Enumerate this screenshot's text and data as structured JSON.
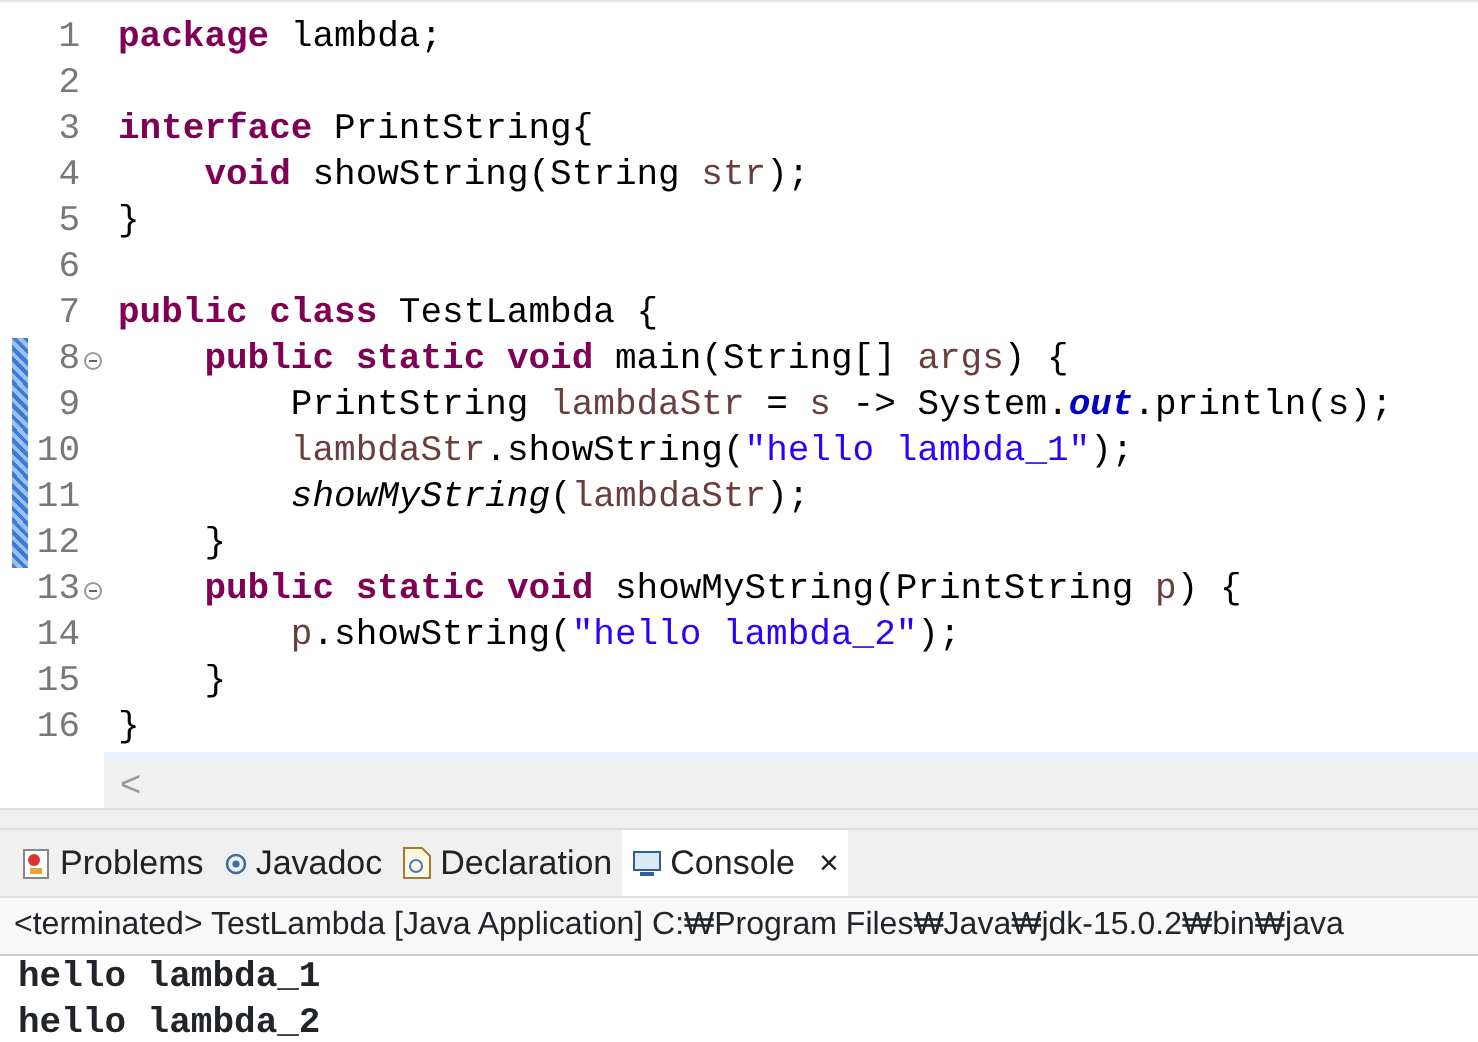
{
  "editor": {
    "lines": [
      {
        "number": "1",
        "changed": false,
        "foldable": false,
        "tokens": [
          {
            "kind": "kw",
            "text": "package"
          },
          {
            "kind": "plain",
            "text": " lambda;"
          }
        ]
      },
      {
        "number": "2",
        "changed": false,
        "foldable": false
      },
      {
        "number": "3",
        "changed": false,
        "foldable": false,
        "tokens": [
          {
            "kind": "kw",
            "text": "interface"
          },
          {
            "kind": "plain",
            "text": " PrintString{"
          }
        ]
      },
      {
        "number": "4",
        "changed": false,
        "foldable": false,
        "tokens": [
          {
            "kind": "kw",
            "text": "    void"
          },
          {
            "kind": "plain",
            "text": " showString(String "
          },
          {
            "kind": "var",
            "text": "str"
          },
          {
            "kind": "plain",
            "text": ");"
          }
        ]
      },
      {
        "number": "5",
        "changed": false,
        "foldable": false,
        "tokens": [
          {
            "kind": "plain",
            "text": "}"
          }
        ]
      },
      {
        "number": "6",
        "changed": false,
        "foldable": false
      },
      {
        "number": "7",
        "changed": false,
        "foldable": false,
        "tokens": [
          {
            "kind": "kw",
            "text": "public"
          },
          {
            "kind": "kw",
            "text": " class"
          },
          {
            "kind": "plain",
            "text": " TestLambda {"
          }
        ]
      },
      {
        "number": "8",
        "changed": true,
        "foldable": true,
        "tokens": [
          {
            "kind": "kw",
            "text": "    public"
          },
          {
            "kind": "kw",
            "text": " static"
          },
          {
            "kind": "kw",
            "text": " void"
          },
          {
            "kind": "plain",
            "text": " main(String[] "
          },
          {
            "kind": "var",
            "text": "args"
          },
          {
            "kind": "plain",
            "text": ") {"
          }
        ]
      },
      {
        "number": "9",
        "changed": true,
        "foldable": false,
        "tokens": [
          {
            "kind": "plain",
            "text": "        PrintString "
          },
          {
            "kind": "var",
            "text": "lambdaStr"
          },
          {
            "kind": "plain",
            "text": " = "
          },
          {
            "kind": "var",
            "text": "s"
          },
          {
            "kind": "plain",
            "text": " -> System."
          },
          {
            "kind": "field",
            "text": "out"
          },
          {
            "kind": "plain",
            "text": ".println(s);"
          }
        ]
      },
      {
        "number": "10",
        "changed": true,
        "foldable": false,
        "tokens": [
          {
            "kind": "var",
            "text": "        lambdaStr"
          },
          {
            "kind": "plain",
            "text": ".showString("
          },
          {
            "kind": "str",
            "text": "\"hello lambda_1\""
          },
          {
            "kind": "plain",
            "text": ");"
          }
        ]
      },
      {
        "number": "11",
        "changed": true,
        "foldable": false,
        "tokens": [
          {
            "kind": "static",
            "text": "        showMyString"
          },
          {
            "kind": "plain",
            "text": "("
          },
          {
            "kind": "var",
            "text": "lambdaStr"
          },
          {
            "kind": "plain",
            "text": ");"
          }
        ]
      },
      {
        "number": "12",
        "changed": true,
        "foldable": false,
        "tokens": [
          {
            "kind": "plain",
            "text": "    }"
          }
        ]
      },
      {
        "number": "13",
        "changed": false,
        "foldable": true,
        "tokens": [
          {
            "kind": "kw",
            "text": "    public"
          },
          {
            "kind": "kw",
            "text": " static"
          },
          {
            "kind": "kw",
            "text": " void"
          },
          {
            "kind": "plain",
            "text": " showMyString(PrintString "
          },
          {
            "kind": "var",
            "text": "p"
          },
          {
            "kind": "plain",
            "text": ") {"
          }
        ]
      },
      {
        "number": "14",
        "changed": false,
        "foldable": false,
        "tokens": [
          {
            "kind": "var",
            "text": "        p"
          },
          {
            "kind": "plain",
            "text": ".showString("
          },
          {
            "kind": "str",
            "text": "\"hello lambda_2\""
          },
          {
            "kind": "plain",
            "text": ");"
          }
        ]
      },
      {
        "number": "15",
        "changed": false,
        "foldable": false,
        "tokens": [
          {
            "kind": "plain",
            "text": "    }"
          }
        ]
      },
      {
        "number": "16",
        "changed": false,
        "foldable": false,
        "tokens": [
          {
            "kind": "plain",
            "text": "}"
          }
        ]
      }
    ],
    "scroll_left": "<"
  },
  "views": {
    "tabs": [
      {
        "label": "Problems",
        "kind": "problems",
        "selected": false
      },
      {
        "label": "Javadoc",
        "kind": "javadoc",
        "selected": false
      },
      {
        "label": "Declaration",
        "kind": "declaration",
        "selected": false
      },
      {
        "label": "Console",
        "kind": "console",
        "selected": true,
        "close": "×"
      }
    ],
    "status": "<terminated> TestLambda [Java Application] C:₩Program Files₩Java₩jdk-15.0.2₩bin₩java",
    "output": [
      "hello lambda_1",
      "hello lambda_2"
    ]
  }
}
